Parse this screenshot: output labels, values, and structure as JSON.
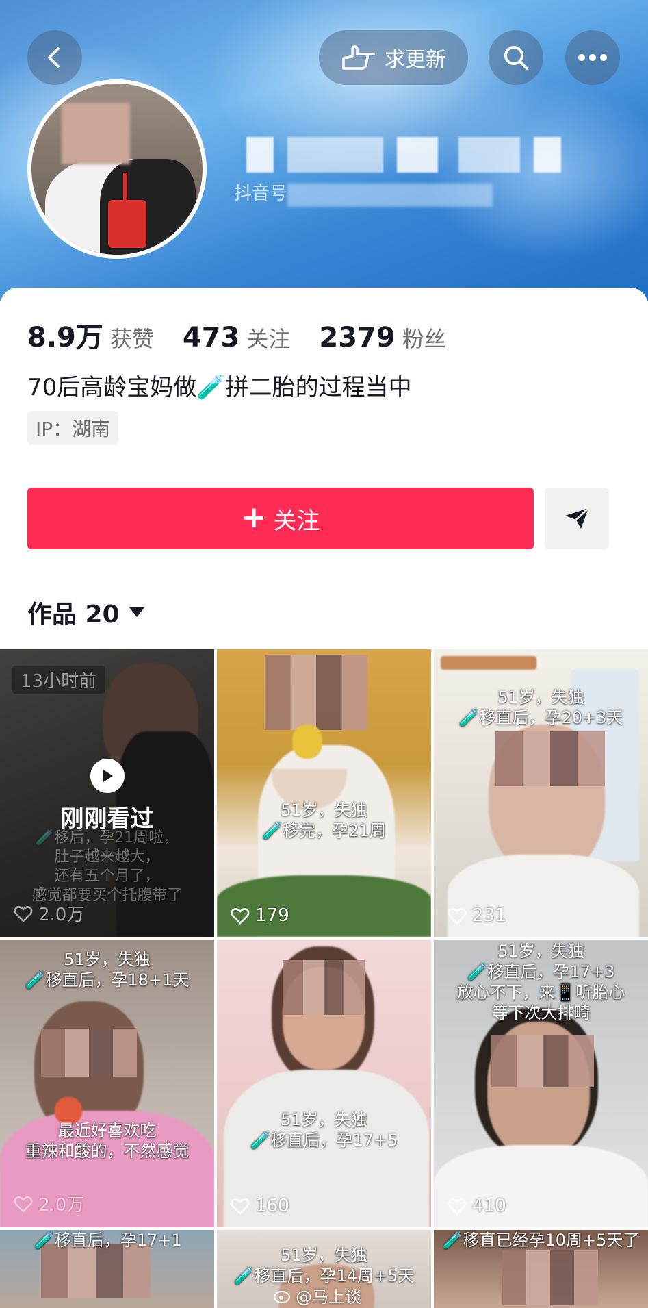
{
  "header": {
    "update_label": "求更新",
    "douyin_id_prefix": "抖音号"
  },
  "profile": {
    "stats": [
      {
        "value": "8.9万",
        "label": "获赞"
      },
      {
        "value": "473",
        "label": "关注"
      },
      {
        "value": "2379",
        "label": "粉丝"
      }
    ],
    "bio": "70后高龄宝妈做🧪拼二胎的过程当中",
    "ip": "IP：湖南",
    "follow_label": "关注",
    "works_label": "作品 20"
  },
  "colors": {
    "accent": "#fe2c55",
    "banner": "#3a86d4"
  },
  "videos": [
    {
      "time": "13小时前",
      "overlay": "刚刚看过",
      "caption": "🧪移后，孕21周啦，\n肚子越来越大，\n还有五个月了，\n感觉都要买个托腹带了",
      "likes": "2.0万"
    },
    {
      "caption": "51岁，失独\n🧪移完，孕21周",
      "likes": "179"
    },
    {
      "caption": "51岁，失独\n🧪移直后，孕20+3天",
      "likes": "231"
    },
    {
      "caption": "51岁，失独\n🧪移直后，孕18+1天",
      "caption2": "最近好喜欢吃\n重辣和酸的，不然感觉",
      "likes": "2.0万"
    },
    {
      "caption": "51岁，失独\n🧪移直后，孕17+5",
      "likes": "160"
    },
    {
      "caption": "51岁，失独\n🧪移直后，孕17+3\n放心不下，来📱听胎心\n等下次大排畸",
      "likes": "410"
    },
    {
      "caption": "🧪移直后，孕17+1"
    },
    {
      "caption": "51岁，失独\n🧪移直后，孕14周+5天"
    },
    {
      "caption": "🧪移直已经孕10周+5天了"
    }
  ],
  "watermark": "@马上谈"
}
